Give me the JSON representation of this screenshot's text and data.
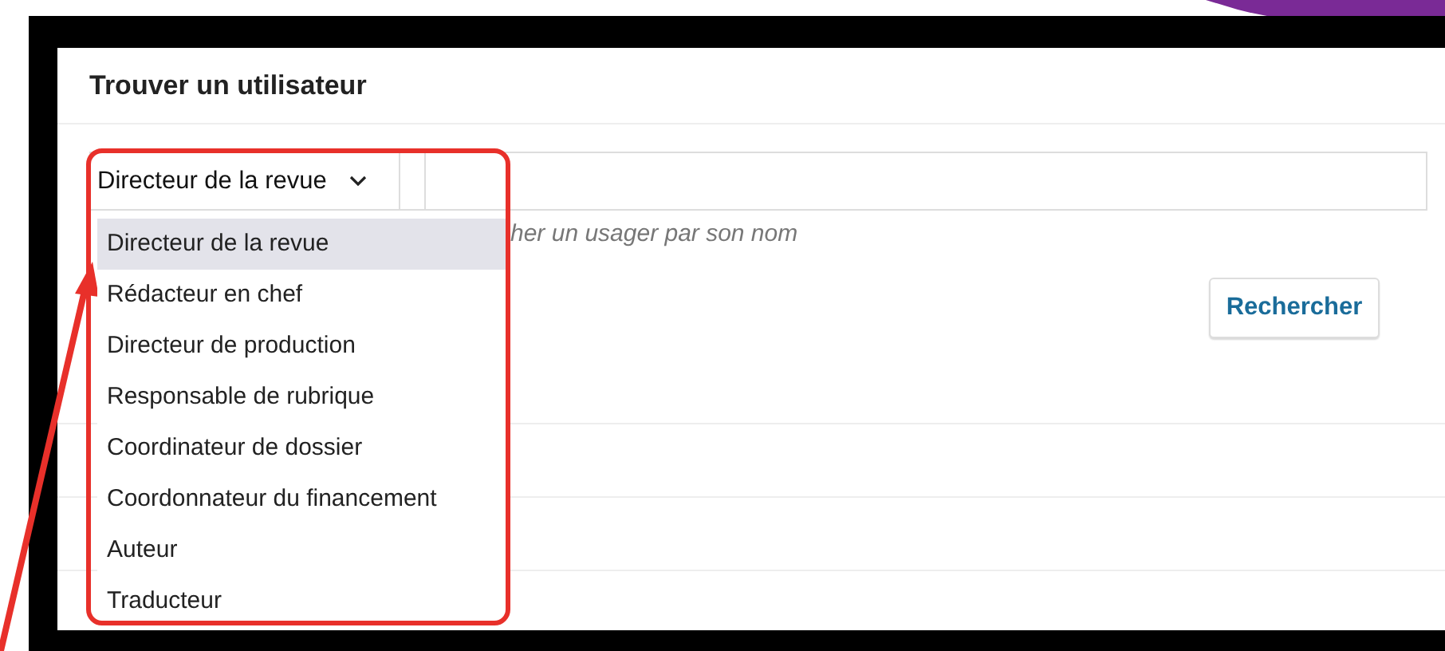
{
  "panel": {
    "title": "Trouver un utilisateur"
  },
  "role_select": {
    "value": "Directeur de la revue",
    "expanded": true,
    "options": [
      {
        "label": "Directeur de la revue",
        "selected": true
      },
      {
        "label": "Rédacteur en chef",
        "selected": false
      },
      {
        "label": "Directeur de production",
        "selected": false
      },
      {
        "label": "Responsable de rubrique",
        "selected": false
      },
      {
        "label": "Coordinateur de dossier",
        "selected": false
      },
      {
        "label": "Coordonnateur du financement",
        "selected": false
      },
      {
        "label": "Auteur",
        "selected": false
      },
      {
        "label": "Traducteur",
        "selected": false
      }
    ]
  },
  "search_field": {
    "help_text": "her un usager par son nom"
  },
  "search_button": {
    "label": "Rechercher"
  }
}
